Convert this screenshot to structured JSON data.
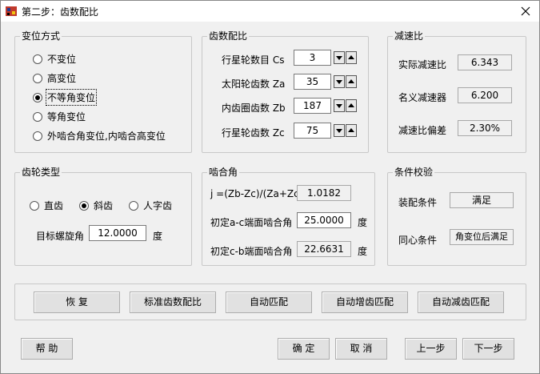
{
  "window": {
    "title": "第二步：齿数配比"
  },
  "shift": {
    "label": "变位方式",
    "options": [
      "不变位",
      "高变位",
      "不等角变位",
      "等角变位",
      "外啮合角变位,内啮合高变位"
    ],
    "selected": 2
  },
  "teeth": {
    "label": "齿数配比",
    "rows": [
      {
        "label": "行星轮数目 Cs",
        "value": "3"
      },
      {
        "label": "太阳轮齿数 Za",
        "value": "35"
      },
      {
        "label": "内齿圈齿数 Zb",
        "value": "187"
      },
      {
        "label": "行星轮齿数 Zc",
        "value": "75"
      }
    ]
  },
  "ratio": {
    "label": "减速比",
    "actual_label": "实际减速比",
    "actual_value": "6.343",
    "nominal_label": "名义减速器",
    "nominal_value": "6.200",
    "deviation_label": "减速比偏差",
    "deviation_value": "2.30%"
  },
  "gear_type": {
    "label": "齿轮类型",
    "options": [
      "直齿",
      "斜齿",
      "人字齿"
    ],
    "selected": 1,
    "helix_label": "目标螺旋角",
    "helix_value": "12.0000",
    "helix_unit": "度"
  },
  "mesh": {
    "label": "啮合角",
    "formula_label": "j =(Zb-Zc)/(Za+Zc)",
    "formula_value": "1.0182",
    "ac_label": "初定a-c端面啮合角",
    "ac_value": "25.0000",
    "ac_unit": "度",
    "cb_label": "初定c-b端面啮合角",
    "cb_value": "22.6631",
    "cb_unit": "度"
  },
  "check": {
    "label": "条件校验",
    "assembly_label": "装配条件",
    "assembly_value": "满足",
    "concentric_label": "同心条件",
    "concentric_value": "角变位后满足"
  },
  "actions": {
    "restore": "恢 复",
    "standard": "标准齿数配比",
    "auto": "自动匹配",
    "auto_inc": "自动增齿匹配",
    "auto_dec": "自动减齿匹配"
  },
  "footer": {
    "help": "帮 助",
    "ok": "确 定",
    "cancel": "取 消",
    "prev": "上一步",
    "next": "下一步"
  }
}
